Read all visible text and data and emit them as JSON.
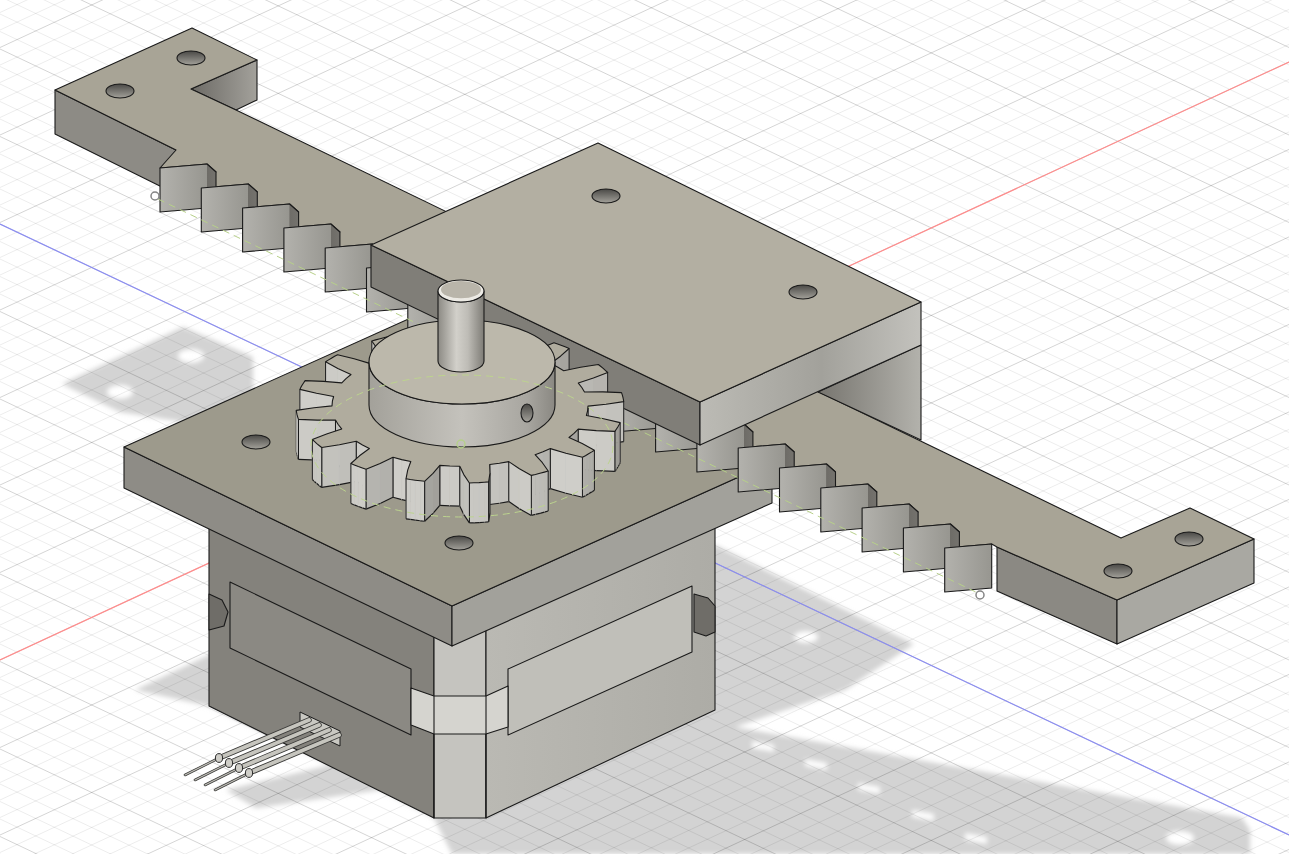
{
  "viewport": {
    "grid": true,
    "axes": true,
    "shadows": true
  }
}
